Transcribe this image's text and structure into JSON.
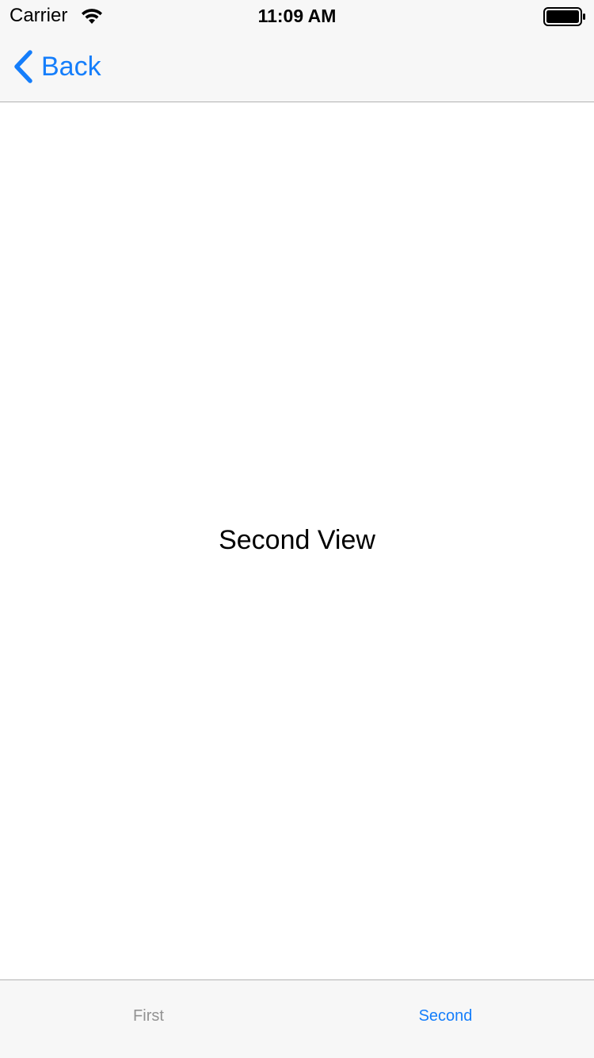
{
  "status_bar": {
    "carrier": "Carrier",
    "time": "11:09 AM",
    "wifi_icon": "wifi-icon",
    "battery_icon": "battery-icon"
  },
  "nav_bar": {
    "back_label": "Back",
    "back_icon": "chevron-left-icon"
  },
  "content": {
    "label": "Second View"
  },
  "tab_bar": {
    "tabs": [
      {
        "label": "First",
        "selected": false
      },
      {
        "label": "Second",
        "selected": true
      }
    ]
  },
  "colors": {
    "accent": "#157efb",
    "inactive_tab": "#929292",
    "bar_background": "#f7f7f7",
    "separator": "#b2b2b2"
  }
}
